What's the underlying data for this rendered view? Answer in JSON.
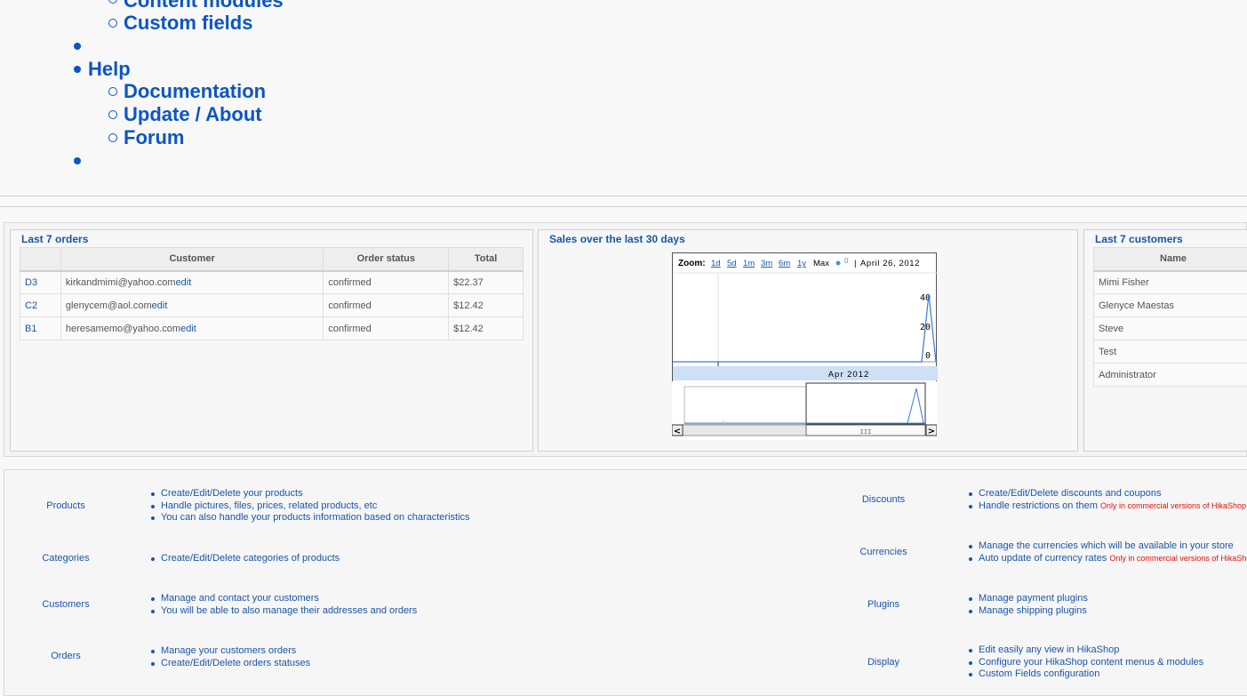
{
  "nav": {
    "content_modules": "Content modules",
    "custom_fields": "Custom fields",
    "help": "Help",
    "documentation": "Documentation",
    "update_about": "Update / About",
    "forum": "Forum"
  },
  "orders_panel": {
    "title": "Last 7 orders",
    "columns": [
      "",
      "Customer",
      "Order status",
      "Total"
    ],
    "rows": [
      {
        "id": "D3",
        "email": "kirkandmimi@yahoo.com",
        "edit": "edit",
        "status": "confirmed",
        "total": "$22.37"
      },
      {
        "id": "C2",
        "email": "glenycem@aol.com",
        "edit": "edit",
        "status": "confirmed",
        "total": "$12.42"
      },
      {
        "id": "B1",
        "email": "heresamemo@yahoo.com",
        "edit": "edit",
        "status": "confirmed",
        "total": "$12.42"
      }
    ]
  },
  "sales_panel": {
    "title": "Sales over the last 30 days",
    "zoom_label": "Zoom:",
    "zoom_links": [
      "1d",
      "5d",
      "1m",
      "3m",
      "6m",
      "1y"
    ],
    "zoom_max": "Max",
    "zoom_value": "0",
    "date_label": "April 26, 2012",
    "y_ticks": [
      "40",
      "20",
      "0"
    ],
    "month_label": "Apr 2012",
    "scroll_left": "<",
    "scroll_right": ">",
    "scroll_grip": "III"
  },
  "chart_data": {
    "type": "line",
    "title": "Sales over the last 30 days",
    "x": [
      "Apr 2012",
      "April 26, 2012"
    ],
    "series": [
      {
        "values": [
          0,
          0,
          0,
          40,
          0
        ]
      }
    ],
    "ylim": [
      0,
      40
    ],
    "y_ticks": [
      0,
      20,
      40
    ],
    "grid": false
  },
  "customers_panel": {
    "title": "Last 7 customers",
    "column": "Name",
    "rows": [
      "Mimi Fisher",
      "Glenyce Maestas",
      "Steve",
      "Test",
      "Administrator"
    ]
  },
  "features": {
    "left": [
      {
        "title": "Products",
        "items": [
          "Create/Edit/Delete your products",
          "Handle pictures, files, prices, related products, etc",
          "You can also handle your products information based on characteristics"
        ]
      },
      {
        "title": "Categories",
        "items": [
          "Create/Edit/Delete categories of products"
        ]
      },
      {
        "title": "Customers",
        "items": [
          "Manage and contact your customers",
          "You will be able to also manage their addresses and orders"
        ]
      },
      {
        "title": "Orders",
        "items": [
          "Manage your customers orders",
          "Create/Edit/Delete orders statuses"
        ]
      }
    ],
    "right": [
      {
        "title": "Discounts",
        "items": [
          "Create/Edit/Delete discounts and coupons",
          "Handle restrictions on them"
        ],
        "note": "Only in commercial versions of HikaShop"
      },
      {
        "title": "Currencies",
        "items": [
          "Manage the currencies which will be available in your store",
          "Auto update of currency rates"
        ],
        "note": "Only in commercial versions of HikaShop"
      },
      {
        "title": "Plugins",
        "items": [
          "Manage payment plugins",
          "Manage shipping plugins"
        ]
      },
      {
        "title": "Display",
        "items": [
          "Edit easily any view in HikaShop",
          "Configure your HikaShop content menus & modules",
          "Custom Fields configuration"
        ]
      }
    ]
  }
}
